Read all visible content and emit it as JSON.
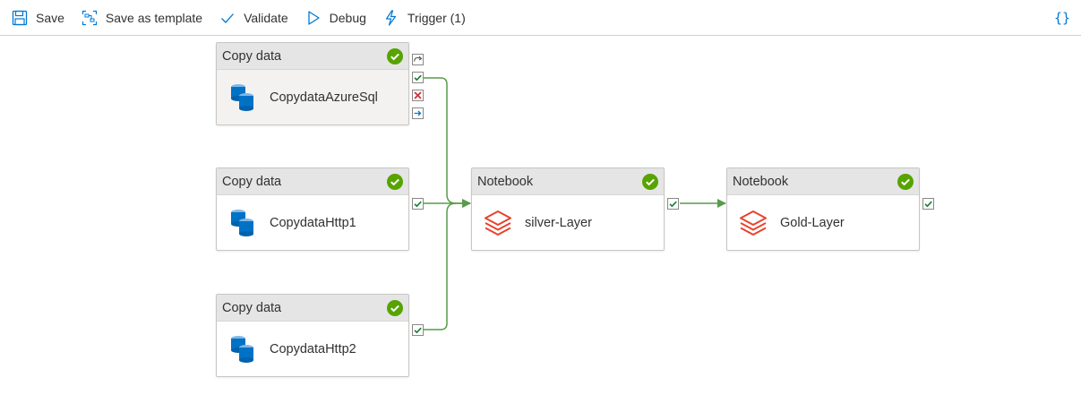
{
  "toolbar": {
    "save": "Save",
    "save_template": "Save as template",
    "validate": "Validate",
    "debug": "Debug",
    "trigger": "Trigger (1)",
    "code": "{}"
  },
  "activities": [
    {
      "type": "Copy data",
      "name": "CopydataAzureSql",
      "status": "succeeded"
    },
    {
      "type": "Copy data",
      "name": "CopydataHttp1",
      "status": "succeeded"
    },
    {
      "type": "Copy data",
      "name": "CopydataHttp2",
      "status": "succeeded"
    },
    {
      "type": "Notebook",
      "name": "silver-Layer",
      "status": "succeeded"
    },
    {
      "type": "Notebook",
      "name": "Gold-Layer",
      "status": "succeeded"
    }
  ],
  "colors": {
    "success": "#57a300",
    "connector": "#579c4a",
    "fail": "#d13438",
    "accent": "#0078d4",
    "databricks": "#e8432c"
  }
}
